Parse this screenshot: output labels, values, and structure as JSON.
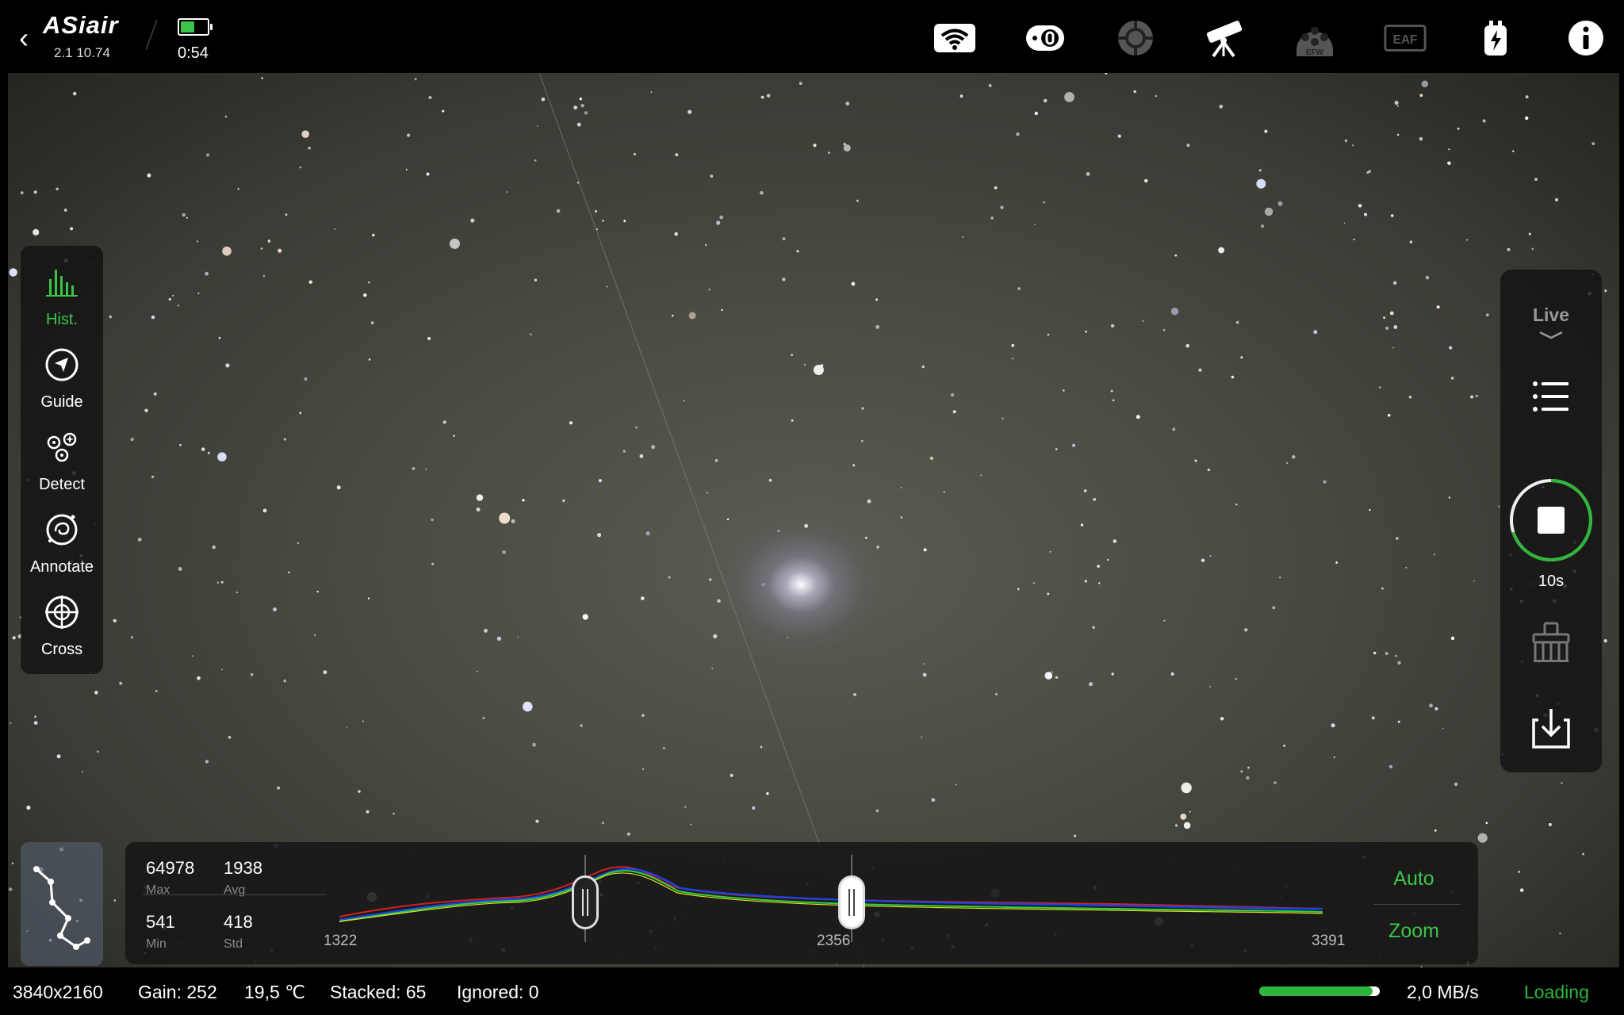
{
  "app": {
    "logo": "ASiair",
    "version": "2.1 10.74",
    "elapsed": "0:54",
    "battery_level": 0.6
  },
  "top_icons": [
    "wifi-icon",
    "camera-icon",
    "guide-scope-icon",
    "telescope-icon",
    "efw-icon",
    "eaf-icon",
    "power-icon",
    "info-icon"
  ],
  "top_icon_labels": {
    "efw": "EFW",
    "eaf": "EAF"
  },
  "left_tools": [
    {
      "label": "Hist.",
      "icon": "histogram-icon",
      "active": true
    },
    {
      "label": "Guide",
      "icon": "guide-icon",
      "active": false
    },
    {
      "label": "Detect",
      "icon": "detect-icon",
      "active": false
    },
    {
      "label": "Annotate",
      "icon": "annotate-icon",
      "active": false
    },
    {
      "label": "Cross",
      "icon": "crosshair-icon",
      "active": false
    }
  ],
  "right_panel": {
    "mode": "Live",
    "exposure": "10s",
    "exposure_progress": 0.7
  },
  "histogram": {
    "max": "64978",
    "max_label": "Max",
    "avg": "1938",
    "avg_label": "Avg",
    "min": "541",
    "min_label": "Min",
    "std": "418",
    "std_label": "Std",
    "ticks": [
      "1322",
      "2356",
      "3391"
    ],
    "auto_label": "Auto",
    "zoom_label": "Zoom"
  },
  "status": {
    "resolution": "3840x2160",
    "gain": "Gain: 252",
    "temperature": "19,5 ℃",
    "stacked": "Stacked: 65",
    "ignored": "Ignored: 0",
    "transfer_progress": 0.94,
    "rate": "2,0 MB/s",
    "state": "Loading"
  },
  "colors": {
    "accent": "#3cc44a",
    "panel": "#121212"
  }
}
